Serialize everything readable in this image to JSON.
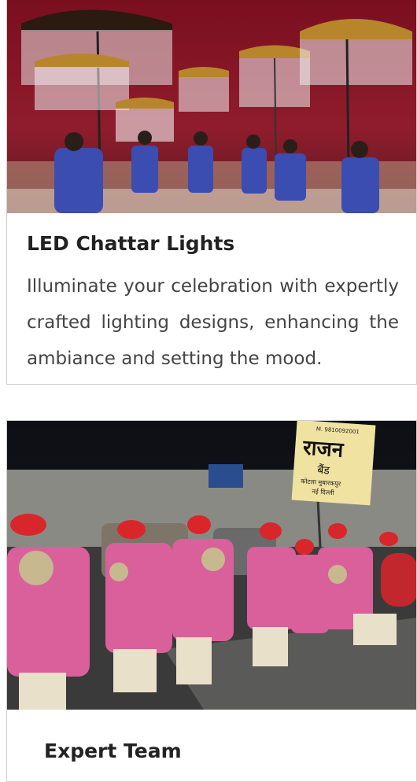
{
  "cards": [
    {
      "title": "LED Chattar Lights",
      "description": "Illuminate your celebration with expertly crafted lighting designs, enhancing the ambiance and setting the mood.",
      "image": "led-chattar-umbrella-lights-photo"
    },
    {
      "title": "Expert Team",
      "image": "brass-band-team-photo",
      "sign_text": [
        "M. 9810092001",
        "राजन",
        "बैंड",
        "कोटला मुबारकपुर",
        "नई दिल्ली"
      ]
    }
  ]
}
